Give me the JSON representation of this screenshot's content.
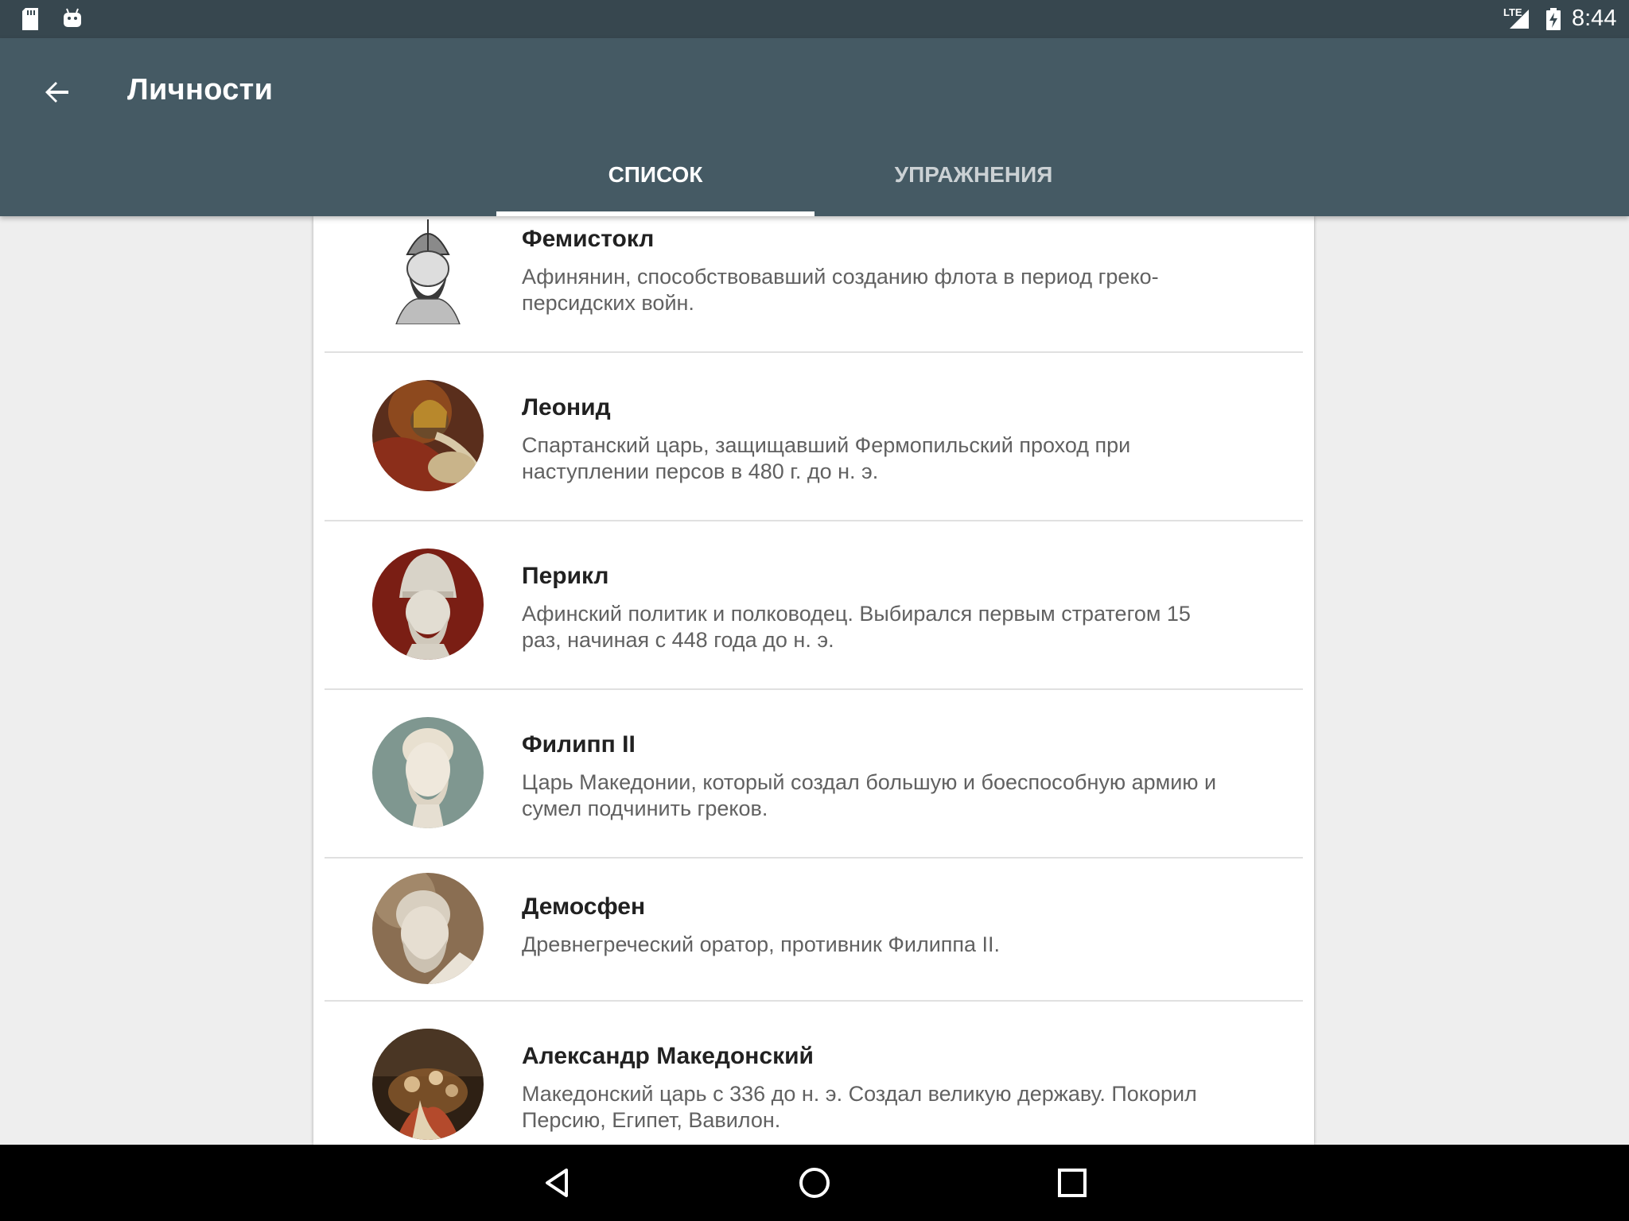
{
  "status_bar": {
    "time": "8:44",
    "network": "LTE",
    "icons": [
      "sd-card-icon",
      "android-debug-icon",
      "signal-icon",
      "battery-charging-icon"
    ]
  },
  "app_bar": {
    "title": "Личности",
    "back_icon": "arrow-back-icon",
    "background": "#455a64",
    "tabs": [
      {
        "label": "СПИСОК",
        "selected": true
      },
      {
        "label": "УПРАЖНЕНИЯ",
        "selected": false
      }
    ]
  },
  "persons": [
    {
      "name": "Фемистокл",
      "description": "Афинянин, способствовавший созданию флота в период греко-персидских войн."
    },
    {
      "name": "Леонид",
      "description": "Спартанский царь, защищавший Фермопильский проход при наступлении персов в 480 г. до н. э."
    },
    {
      "name": "Перикл",
      "description": "Афинский политик и полководец. Выбирался первым стратегом 15 раз, начиная с 448 года до н. э."
    },
    {
      "name": "Филипп II",
      "description": "Царь Македонии, который создал большую и боеспособную армию и сумел подчинить греков."
    },
    {
      "name": "Демосфен",
      "description": "Древнегреческий оратор, противник Филиппа II."
    },
    {
      "name": "Александр Македонский",
      "description": "Македонский царь с 336 до н. э. Создал великую державу. Покорил Персию, Египет, Вавилон."
    }
  ],
  "nav_bar": {
    "buttons": [
      "back-triangle-icon",
      "home-circle-icon",
      "recents-square-icon"
    ]
  }
}
